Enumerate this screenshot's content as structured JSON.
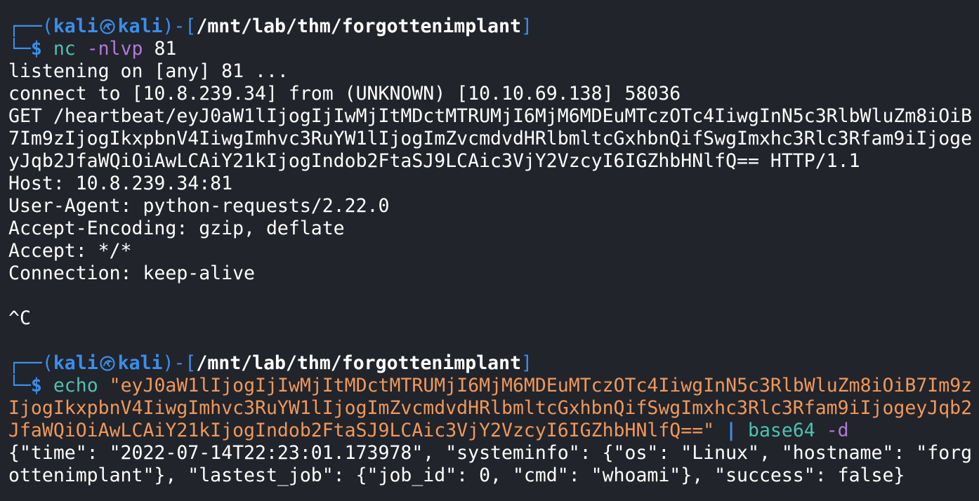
{
  "session1": {
    "frame_top": "┌──(",
    "user": "kali",
    "host": "kali",
    "frame_mid": ")-[",
    "path": "/mnt/lab/thm/forgottenimplant",
    "frame_end": "]",
    "frame_bottom": "└─",
    "prompt": "$ ",
    "cmd": "nc",
    "args": " -nlvp",
    "port": " 81"
  },
  "output1": [
    "listening on [any] 81 ...",
    "connect to [10.8.239.34] from (UNKNOWN) [10.10.69.138] 58036",
    "GET /heartbeat/eyJ0aW1lIjogIjIwMjItMDctMTRUMjI6MjM6MDEuMTczOTc4IiwgInN5c3RlbWluZm8iOiB",
    "7Im9zIjogIkxpbnV4IiwgImhvc3RuYW1lIjogImZvcmdvdHRlbmltcGxhbnQifSwgImxhc3Rlc3Rfam9iIjoge",
    "yJqb2JfaWQiOiAwLCAiY21kIjogIndob2FtaSJ9LCAic3VjY2VzcyI6IGZhbHNlfQ== HTTP/1.1",
    "Host: 10.8.239.34:81",
    "User-Agent: python-requests/2.22.0",
    "Accept-Encoding: gzip, deflate",
    "Accept: */*",
    "Connection: keep-alive",
    "",
    "^C",
    ""
  ],
  "session2": {
    "frame_top": "┌──(",
    "user": "kali",
    "host": "kali",
    "frame_mid": ")-[",
    "path": "/mnt/lab/thm/forgottenimplant",
    "frame_end": "]",
    "frame_bottom": "└─",
    "prompt": "$ ",
    "cmd": "echo",
    "str_line1": " \"eyJ0aW1lIjogIjIwMjItMDctMTRUMjI6MjM6MDEuMTczOTc4IiwgInN5c3RlbWluZm8iOiB7Im9z",
    "str_line2": "IjogIkxpbnV4IiwgImhvc3RuYW1lIjogImZvcmdvdHRlbmltcGxhbnQifSwgImxhc3Rlc3Rfam9iIjogeyJqb2",
    "str_line3": "JfaWQiOiAwLCAiY21kIjogIndob2FtaSJ9LCAic3VjY2VzcyI6IGZhbHNlfQ==\"",
    "pipe": " | ",
    "cmd2": "base64",
    "args2": " -d"
  },
  "output2": [
    "{\"time\": \"2022-07-14T22:23:01.173978\", \"systeminfo\": {\"os\": \"Linux\", \"hostname\": \"forg",
    "ottenimplant\"}, \"lastest_job\": {\"job_id\": 0, \"cmd\": \"whoami\"}, \"success\": false}"
  ],
  "icons": {
    "user_host_separator": "kali-dragon-icon"
  },
  "colors": {
    "background": "#21242b",
    "text": "#ffffff",
    "frame": "#3b8eea",
    "command": "#4fc1b0",
    "argument": "#b07ad8",
    "string": "#f0985b"
  }
}
